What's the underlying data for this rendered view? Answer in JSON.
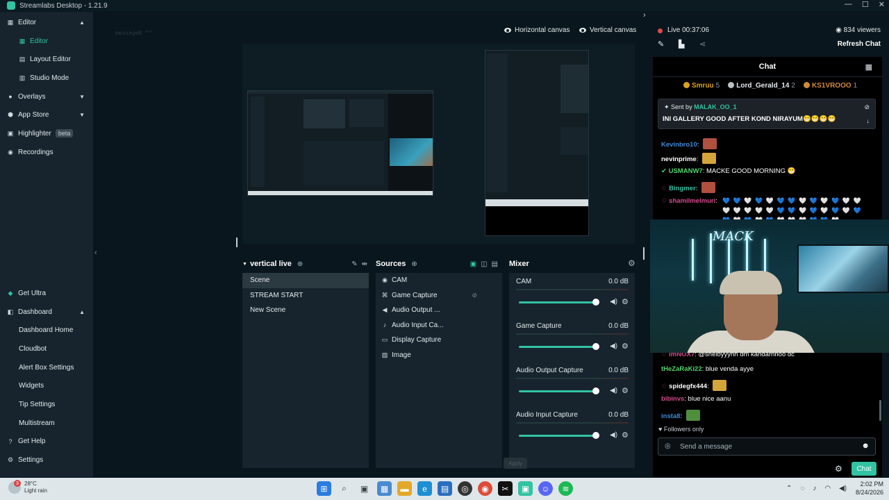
{
  "app": {
    "title": "Streamlabs Desktop - 1.21.9"
  },
  "sidebar": {
    "top_items": [
      {
        "label": "Editor",
        "icon": "editor-icon",
        "expanded": true
      },
      {
        "label": "Editor",
        "icon": "editor-icon",
        "active": true
      },
      {
        "label": "Layout Editor",
        "icon": "layout-editor-icon"
      },
      {
        "label": "Studio Mode",
        "icon": "studio-mode-icon"
      },
      {
        "label": "Overlays",
        "icon": "overlays-icon"
      },
      {
        "label": "App Store",
        "icon": "app-store-icon"
      },
      {
        "label": "Highlighter",
        "icon": "highlighter-icon",
        "badge": "beta"
      },
      {
        "label": "Recordings",
        "icon": "recordings-icon"
      }
    ],
    "bottom_items": [
      {
        "label": "Get Ultra",
        "icon": "ultra-icon"
      },
      {
        "label": "Dashboard",
        "icon": "dashboard-icon"
      },
      {
        "label": "Dashboard Home"
      },
      {
        "label": "Cloudbot"
      },
      {
        "label": "Alert Box Settings"
      },
      {
        "label": "Widgets"
      },
      {
        "label": "Tip Settings"
      },
      {
        "label": "Multistream"
      },
      {
        "label": "Get Help",
        "icon": "help-icon"
      },
      {
        "label": "Settings",
        "icon": "settings-icon"
      }
    ]
  },
  "ghost_text": "messageR \"\"",
  "canvas_toggles": {
    "horizontal": "Horizontal canvas",
    "vertical": "Vertical canvas"
  },
  "scenes": {
    "title": "vertical live",
    "items": [
      "Scene",
      "STREAM START",
      "New Scene"
    ],
    "selected": "Scene"
  },
  "sources": {
    "title": "Sources",
    "items": [
      {
        "label": "CAM",
        "icon": "camera-icon"
      },
      {
        "label": "Game Capture",
        "icon": "gamepad-icon"
      },
      {
        "label": "Audio Output ...",
        "icon": "speaker-icon"
      },
      {
        "label": "Audio Input Ca...",
        "icon": "microphone-icon"
      },
      {
        "label": "Display Capture",
        "icon": "monitor-icon"
      },
      {
        "label": "Image",
        "icon": "image-icon"
      }
    ]
  },
  "mixer": {
    "title": "Mixer",
    "channels": [
      {
        "name": "CAM",
        "db": "0.0 dB",
        "level": 1.0
      },
      {
        "name": "Game Capture",
        "db": "0.0 dB",
        "level": 1.0
      },
      {
        "name": "Audio Output Capture",
        "db": "0.0 dB",
        "level": 1.0
      },
      {
        "name": "Audio Input Capture",
        "db": "0.0 dB",
        "level": 1.0
      }
    ]
  },
  "ghost_button": "Apply",
  "live": {
    "status": "Live 00:37:06",
    "viewers": "834 viewers",
    "refresh": "Refresh Chat"
  },
  "chat": {
    "title": "Chat",
    "leaders": [
      {
        "name": "Smruu",
        "count": "5",
        "color": "#d9a321"
      },
      {
        "name": "Lord_Gerald_14",
        "count": "2",
        "color": "#b9c2c6"
      },
      {
        "name": "KS1VROOO",
        "count": "1",
        "color": "#d08b3b"
      }
    ],
    "pinned": {
      "sent_by": "Sent by",
      "user": "MALAK_OO_1",
      "message": "INI GALLERY GOOD AFTER KOND NIRAYUM😁😁😁😁"
    },
    "messages_top": [
      {
        "user": "Kevinbro10",
        "text": "",
        "color": "#3d8bd8",
        "emote": true
      },
      {
        "user": "nevinprime",
        "text": "",
        "color": "#ffffff",
        "emote": true
      },
      {
        "user": "USMANW7",
        "text": "MACKE GOOD MORNING 😁",
        "color": "#4fd36a",
        "emote": false
      },
      {
        "user": "Bingmer",
        "text": "",
        "color": "#31c3a2",
        "emote": true
      },
      {
        "user": "shamilmelmuri",
        "text": "",
        "color": "#d64a8e",
        "emote": false
      }
    ],
    "hearts": "💙 💙 🤍 💙 🤍 💙 💙 🤍 💙 🤍 💙 🤍 🤍 🤍 🤍 🤍 🤍 🤍 💙 💙 🤍 💙 🤍 💙 🤍 💙 💙 🤍 💙 🤍 💙 🤍 🤍 🤍 💙 💙 🤍",
    "messages_bottom": [
      {
        "user": "imNOX7",
        "text": "@shelbyyyhh dm kandarnnoo dc",
        "color": "#d64a8e"
      },
      {
        "user": "tHeZaRaKi22",
        "text": "blue venda ayye",
        "color": "#4fd36a"
      },
      {
        "user": "spidegfx444",
        "text": "",
        "color": "#ffffff",
        "emote": true
      },
      {
        "user": "bibinvs",
        "text": "blue nice aanu",
        "color": "#d64a8e"
      },
      {
        "user": "insta8",
        "text": "",
        "color": "#3d8bd8",
        "emote": true
      }
    ],
    "followers_only": "Followers only",
    "input_placeholder": "Send a message",
    "send_button": "Chat"
  },
  "webcam_overlay_text": "MACK",
  "taskbar": {
    "weather_temp": "28°C",
    "weather_desc": "Light rain",
    "weather_alert": "3",
    "time": "2:02 PM",
    "date": "8/24/2026",
    "apps": [
      {
        "icon": "windows-start-icon",
        "color": "#2b7de0"
      },
      {
        "icon": "search-icon",
        "color": "#3a4248"
      },
      {
        "icon": "task-view-icon",
        "color": "#3a4248"
      },
      {
        "icon": "widgets-icon",
        "color": "#4a8ad0"
      },
      {
        "icon": "file-explorer-icon",
        "color": "#e3a82b"
      },
      {
        "icon": "edge-icon",
        "color": "#1e8fd2"
      },
      {
        "icon": "store-icon",
        "color": "#2a6fbf"
      },
      {
        "icon": "obs-icon",
        "color": "#333333"
      },
      {
        "icon": "chrome-icon",
        "color": "#dd4b39"
      },
      {
        "icon": "capcut-icon",
        "color": "#111111"
      },
      {
        "icon": "streamlabs-icon",
        "color": "#31c3a2"
      },
      {
        "icon": "discord-icon",
        "color": "#5865f2"
      },
      {
        "icon": "spotify-icon",
        "color": "#1db954"
      }
    ]
  }
}
